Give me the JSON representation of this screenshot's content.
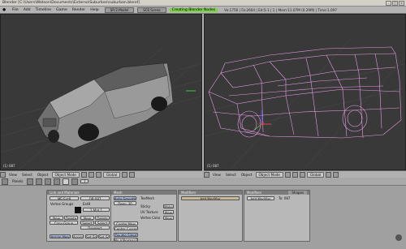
{
  "window": {
    "title": "Blender [C:\\Users\\Watson\\Documents\\Externo\\Suburban\\suburban.blend]"
  },
  "menubar": {
    "items": [
      "File",
      "Add",
      "Timeline",
      "Game",
      "Render",
      "Help"
    ],
    "screen_select": "SR:2-Model",
    "scene_select": "SCE:Scene",
    "highlight": "Creating Blender Nodes",
    "stats": "Ve:1756 | Fa:2604 | Ed:5-1 | 1 | Mem:11.07M (0.29M) | Time:1.097"
  },
  "viewport_left": {
    "corner_label": "(1) 087",
    "footer": {
      "view": "View",
      "select": "Select",
      "object": "Object",
      "mode": "Object Mode",
      "orient": "Global"
    }
  },
  "viewport_right": {
    "corner_label": "(1) 087",
    "footer": {
      "view": "View",
      "select": "Select",
      "object": "Object",
      "mode": "Object Mode",
      "orient": "Global"
    }
  },
  "buttons_header": {
    "panels": "Panels",
    "frame": "1"
  },
  "link_panel": {
    "header": "Link and Materials",
    "me_field": "ME:Ext8",
    "ob_field": "OB:087",
    "vertex_groups": "Vertex Groups",
    "mat_label": "Ext8",
    "mat_index": "1 Mat 1",
    "row1": [
      "New",
      "Delete",
      "New",
      "Delete"
    ],
    "row2": [
      "Copy Group",
      "Select",
      "Select",
      "Deselect"
    ],
    "assign_new": "Assign New",
    "assign": "Assign",
    "set_smooth": "Set Smooth",
    "set_solid": "Set Solid"
  },
  "mesh_panel": {
    "header": "Mesh",
    "auto_smooth": "Auto Smooth",
    "degr": "Degr: 30",
    "sticky": "Sticky",
    "uv_texture": "UV Texture",
    "vertex_color": "Vertex Color",
    "make": "Make",
    "new": "New",
    "tex_mesh": "TexMesh",
    "center_new": "Center New",
    "center_cursor": "Center Cursor",
    "double_sided": "Double Sided",
    "no_v_normal_flip": "No V.Normal Flip"
  },
  "modifiers_panel": {
    "header": "Modifiers",
    "add_modifier": "Add Modifier"
  },
  "shapes_panel": {
    "header": "Modifiers",
    "shapes_tab": "Shapes",
    "add_modifier": "Add Modifier",
    "to": "To: 087"
  },
  "colors": {
    "viewport_bg": "#393939",
    "wire": "#e79be6",
    "solid": "#8a8a8a",
    "highlight": "#7fd04c"
  }
}
